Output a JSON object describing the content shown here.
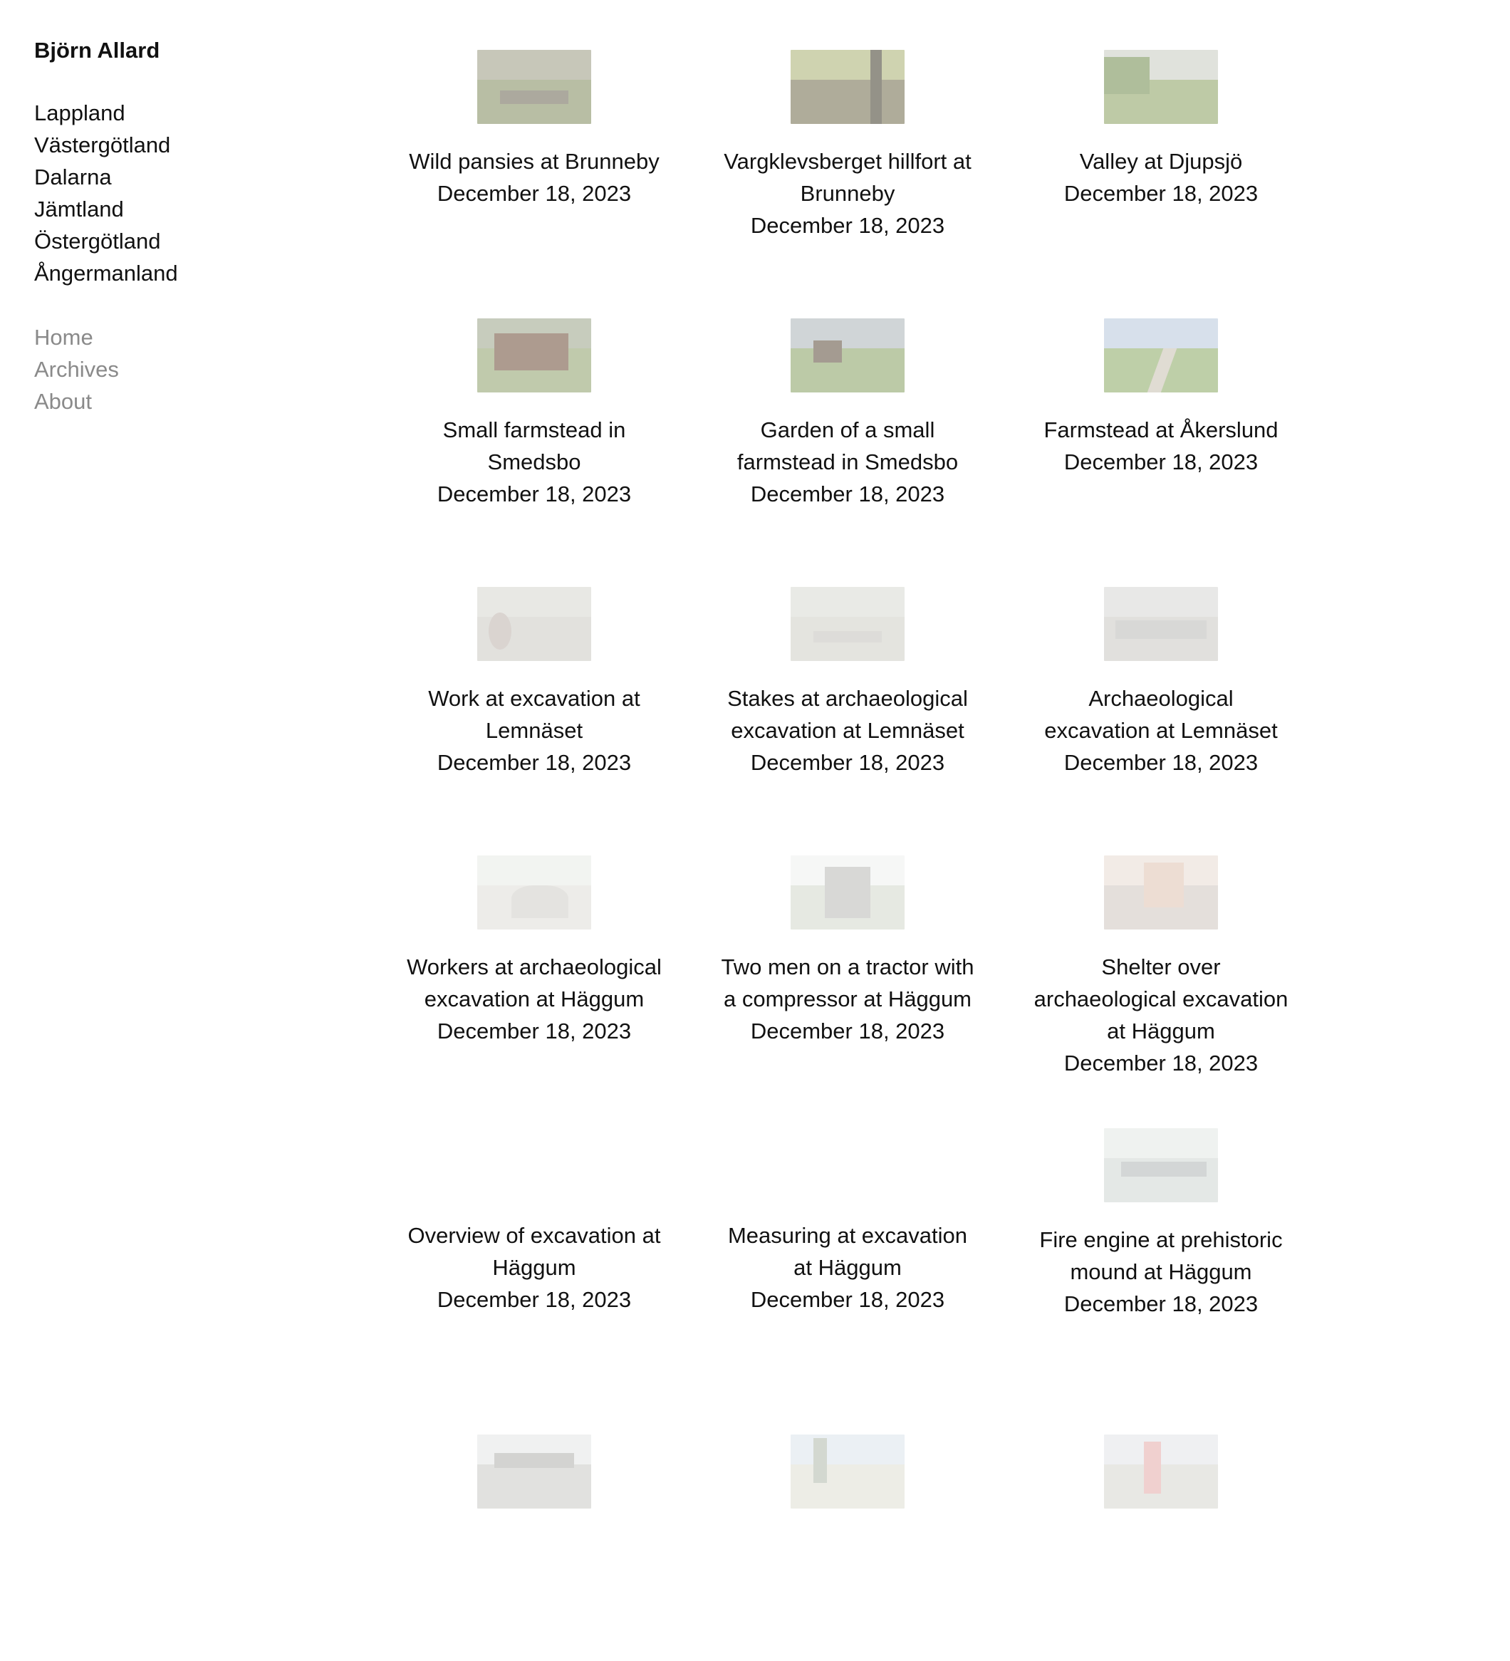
{
  "site": {
    "title": "Björn Allard"
  },
  "regions": [
    "Lappland",
    "Västergötland",
    "Dalarna",
    "Jämtland",
    "Östergötland",
    "Ångermanland"
  ],
  "nav": [
    "Home",
    "Archives",
    "About"
  ],
  "posts": [
    {
      "title": "Wild pansies at Brunneby",
      "date": "December 18, 2023",
      "palette": {
        "sky": "#9a9a80",
        "ground": "#7f8a5a",
        "feat": "#6a6450"
      }
    },
    {
      "title": "Vargklevsberget hillfort at Brunneby",
      "date": "December 18, 2023",
      "palette": {
        "sky": "#a8b070",
        "ground": "#6e6a48",
        "feat": "#3e3a28"
      }
    },
    {
      "title": "Valley at Djupsjö",
      "date": "December 18, 2023",
      "palette": {
        "sky": "#c8ccc0",
        "ground": "#8aa05e",
        "feat": "#6f8a4a"
      }
    },
    {
      "title": "Small farmstead in Smedsbo",
      "date": "December 18, 2023",
      "palette": {
        "sky": "#9aa488",
        "ground": "#8ea06a",
        "feat": "#6b4a34"
      }
    },
    {
      "title": "Garden of a small farmstead in Smedsbo",
      "date": "December 18, 2023",
      "palette": {
        "sky": "#aab4b8",
        "ground": "#86a060",
        "feat": "#5a4a38"
      }
    },
    {
      "title": "Farmstead at Åkerslund",
      "date": "December 18, 2023",
      "palette": {
        "sky": "#b8c8dc",
        "ground": "#8aa862",
        "feat": "#c8c0b0"
      }
    },
    {
      "title": "Work at excavation at Lemnäset",
      "date": "December 18, 2023",
      "palette": {
        "sky": "#9a9a8a",
        "ground": "#7e7a68",
        "feat": "#5a4030"
      }
    },
    {
      "title": "Stakes at archaeological excavation at Lemnäset",
      "date": "December 18, 2023",
      "palette": {
        "sky": "#a0a290",
        "ground": "#8a8870",
        "feat": "#6a6656"
      }
    },
    {
      "title": "Archaeological excavation at Lemnäset",
      "date": "December 18, 2023",
      "palette": {
        "sky": "#9a9c94",
        "ground": "#7a7868",
        "feat": "#505048"
      }
    },
    {
      "title": "Workers at archaeological excavation at Häggum",
      "date": "December 18, 2023",
      "palette": {
        "sky": "#c8cec4",
        "ground": "#b0aea0",
        "feat": "#8a8474"
      }
    },
    {
      "title": "Two men on a tractor with a compressor at Häggum",
      "date": "December 18, 2023",
      "palette": {
        "sky": "#d8dcd8",
        "ground": "#90a080",
        "feat": "#505448"
      }
    },
    {
      "title": "Shelter over archaeological excavation at Häggum",
      "date": "December 18, 2023",
      "palette": {
        "sky": "#c8a890",
        "ground": "#8a7060",
        "feat": "#b06a3a"
      }
    },
    {
      "title": "Overview of excavation at Häggum",
      "date": "December 18, 2023",
      "palette": {
        "sky": "#ffffff",
        "ground": "#ffffff",
        "feat": "#ffffff"
      }
    },
    {
      "title": "Measuring at excavation at Häggum",
      "date": "December 18, 2023",
      "palette": {
        "sky": "#ffffff",
        "ground": "#ffffff",
        "feat": "#ffffff"
      }
    },
    {
      "title": "Fire engine at prehistoric mound at Häggum",
      "date": "December 18, 2023",
      "palette": {
        "sky": "#b8c8c0",
        "ground": "#8a9a90",
        "feat": "#3a4a48"
      }
    },
    {
      "title": "",
      "date": "",
      "palette": {
        "sky": "#c0c4c4",
        "ground": "#7a7a70",
        "feat": "#3a3a34"
      }
    },
    {
      "title": "",
      "date": "",
      "palette": {
        "sky": "#a8c0d0",
        "ground": "#b0b090",
        "feat": "#3a5030"
      }
    },
    {
      "title": "",
      "date": "",
      "palette": {
        "sky": "#b8c0c8",
        "ground": "#9a9a88",
        "feat": "#c0302a"
      }
    }
  ]
}
